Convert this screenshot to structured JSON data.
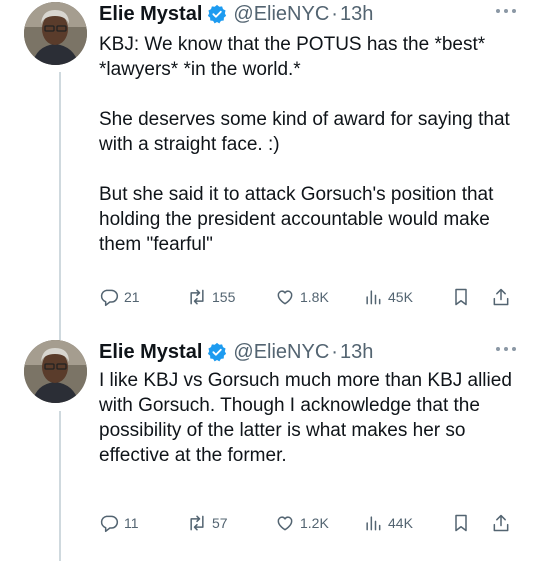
{
  "tweets": [
    {
      "author": {
        "name": "Elie Mystal",
        "handle": "@ElieNYC",
        "time": "13h",
        "verified": true
      },
      "paragraphs": [
        "KBJ: We know that the POTUS has the *best* *lawyers* *in the world.*",
        "She deserves some kind of award for saying that with a straight face. :)",
        "But she said it to attack Gorsuch's position that holding the president accountable would make them \"fearful\""
      ],
      "metrics": {
        "replies": "21",
        "reposts": "155",
        "likes": "1.8K",
        "views": "45K"
      }
    },
    {
      "author": {
        "name": "Elie Mystal",
        "handle": "@ElieNYC",
        "time": "13h",
        "verified": true
      },
      "paragraphs": [
        "I like KBJ vs Gorsuch much more than KBJ allied with Gorsuch. Though I acknowledge that the possibility of the latter is what makes her so effective at the former."
      ],
      "metrics": {
        "replies": "11",
        "reposts": "57",
        "likes": "1.2K",
        "views": "44K"
      }
    }
  ],
  "separator": "·",
  "colors": {
    "text": "#0f1419",
    "secondary": "#536471",
    "verified": "#1d9bf0",
    "thread_line": "#cfd9de"
  },
  "icons": [
    "verified-badge-icon",
    "more-icon",
    "reply-icon",
    "repost-icon",
    "like-icon",
    "views-icon",
    "bookmark-icon",
    "share-icon"
  ]
}
